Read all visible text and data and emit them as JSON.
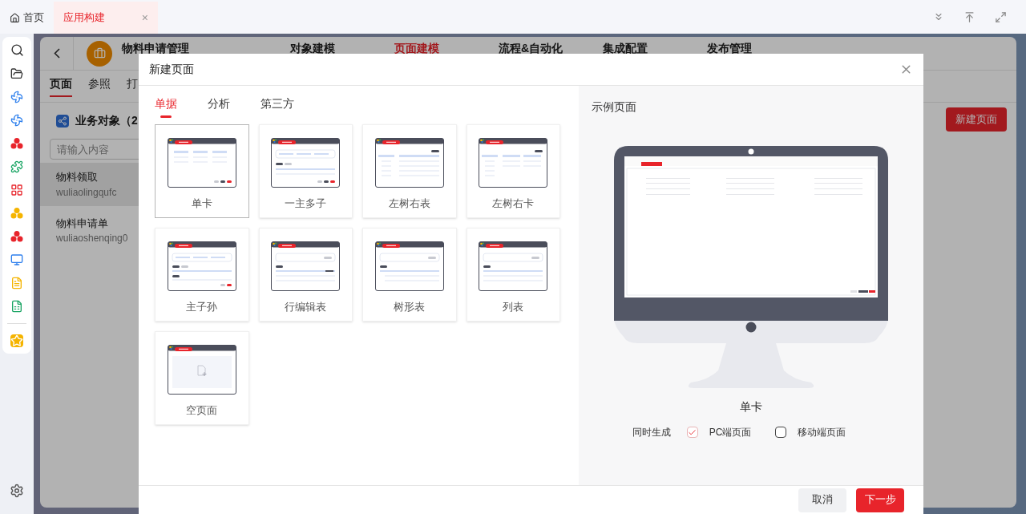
{
  "browser_tabs": [
    {
      "label": "首页",
      "kind": "home",
      "selected": false
    },
    {
      "label": "应用构建",
      "kind": "closable",
      "selected": true,
      "close": "×"
    }
  ],
  "app": {
    "title": "物料申请管理",
    "nav": [
      {
        "label": "对象建模",
        "selected": false
      },
      {
        "label": "页面建模",
        "selected": true
      },
      {
        "label": "流程&自动化",
        "selected": false
      },
      {
        "label": "集成配置",
        "selected": false
      },
      {
        "label": "发布管理",
        "selected": false
      }
    ],
    "subtabs": [
      {
        "label": "页面",
        "selected": true
      },
      {
        "label": "参照",
        "selected": false
      },
      {
        "label": "打",
        "selected": false
      }
    ],
    "objects": {
      "title": "业务对象（2",
      "placeholder": "请输入内容",
      "items": [
        {
          "name": "物料领取",
          "code": "wuliaolingqufc",
          "selected": true
        },
        {
          "name": "物料申请单",
          "code": "wuliaoshenqing0",
          "selected": false
        }
      ]
    },
    "new_page_button": "新建页面"
  },
  "modal": {
    "title": "新建页面",
    "tabs": [
      {
        "label": "单据",
        "selected": true
      },
      {
        "label": "分析",
        "selected": false
      },
      {
        "label": "第三方",
        "selected": false
      }
    ],
    "templates": [
      {
        "label": "单卡",
        "kind": "card",
        "selected": true
      },
      {
        "label": "一主多子",
        "kind": "master-detail",
        "selected": false
      },
      {
        "label": "左树右表",
        "kind": "tree-table",
        "selected": false
      },
      {
        "label": "左树右卡",
        "kind": "tree-card",
        "selected": false
      },
      {
        "label": "主子孙",
        "kind": "three-level",
        "selected": false
      },
      {
        "label": "行编辑表",
        "kind": "row-edit",
        "selected": false
      },
      {
        "label": "树形表",
        "kind": "tree-grid",
        "selected": false
      },
      {
        "label": "列表",
        "kind": "list",
        "selected": false
      },
      {
        "label": "空页面",
        "kind": "blank",
        "selected": false
      }
    ],
    "preview": {
      "title": "示例页面",
      "name": "单卡",
      "generate_label": "同时生成",
      "options": [
        {
          "label": "PC端页面",
          "checked": true
        },
        {
          "label": "移动端页面",
          "checked": false
        }
      ]
    },
    "buttons": [
      {
        "label": "取消",
        "kind": "secondary"
      },
      {
        "label": "下一步",
        "kind": "primary"
      }
    ]
  }
}
